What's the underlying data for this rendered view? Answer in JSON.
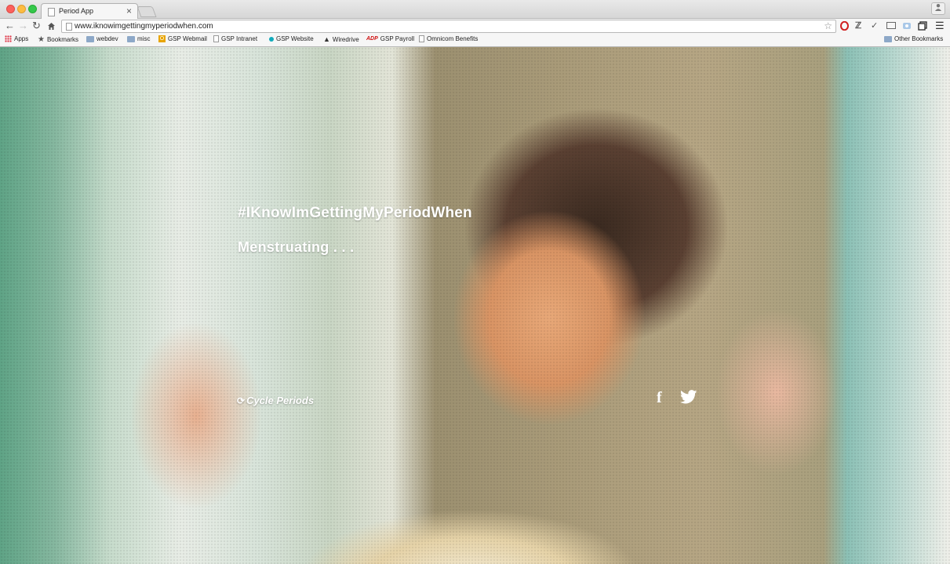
{
  "browser": {
    "tab_title": "Period App",
    "tab_close": "×",
    "url": "www.iknowimgettingmyperiodwhen.com",
    "bookmarks": [
      {
        "label": "Apps",
        "icon": "apps-grid-icon"
      },
      {
        "label": "Bookmarks",
        "icon": "star-icon"
      },
      {
        "label": "webdev",
        "icon": "folder-icon"
      },
      {
        "label": "misc",
        "icon": "folder-icon"
      },
      {
        "label": "GSP Webmail",
        "icon": "outlook-icon"
      },
      {
        "label": "GSP Intranet",
        "icon": "page-icon"
      },
      {
        "label": "GSP Website",
        "icon": "dot-icon"
      },
      {
        "label": "Wiredrive",
        "icon": "flame-icon"
      },
      {
        "label": "GSP Payroll",
        "icon": "adp-icon"
      },
      {
        "label": "Omnicom Benefits",
        "icon": "page-icon"
      }
    ],
    "other_bookmarks": "Other Bookmarks"
  },
  "page": {
    "hashtag": "#IKnowImGettingMyPeriodWhen",
    "status": "Menstruating . . .",
    "cycle_link": "Cycle Periods",
    "social": {
      "facebook": "f"
    }
  },
  "colors": {
    "text": "#ffffff",
    "chrome": "#f6f6f6"
  }
}
